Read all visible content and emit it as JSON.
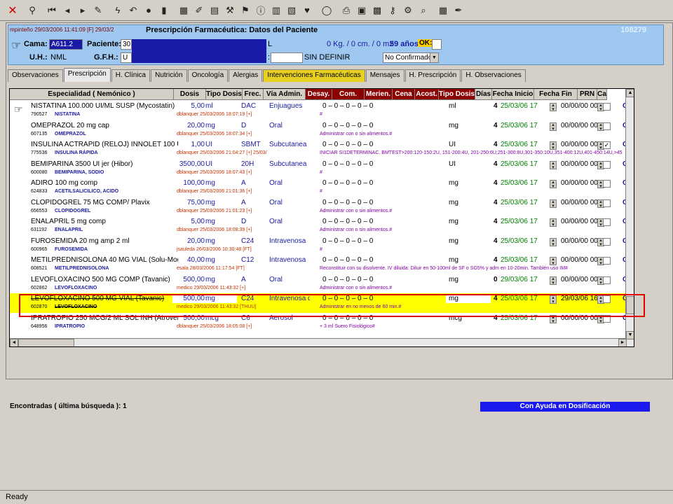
{
  "toolbar": {
    "icons": [
      "close-icon",
      "binoculars-icon",
      "first-icon",
      "prev-icon",
      "next-icon",
      "edit-icon",
      "lightning-icon",
      "undo-icon",
      "record-icon",
      "trash-icon",
      "grid-icon",
      "note-icon",
      "doc-icon",
      "tools-icon",
      "flag-icon",
      "info-icon",
      "table-icon",
      "book-icon",
      "heart-icon",
      "chat-icon",
      "print-icon",
      "photo-icon",
      "calc-icon",
      "key-icon",
      "gear-icon",
      "search-doc-icon",
      "calendar-icon",
      "pen-icon"
    ]
  },
  "patient": {
    "userinfo": "mpinteño 29/03/2006 11:41:09 [F] 29/03/2",
    "title": "Prescripción Farmacéutica: Datos del Paciente",
    "id": "108279",
    "cama_label": "Cama:",
    "cama_value": "A611.2",
    "paciente_label": "Paciente:",
    "paciente_value": "30",
    "paciente_tail": "L",
    "weight": "0 Kg. / 0 cm. / 0 m2",
    "age": "59 años",
    "ok_label": "OK:",
    "uh_label": "U.H.:",
    "uh_value": "NML",
    "gfh_label": "G.F.H.:",
    "gfh_value": "U",
    "def_label": ":",
    "def_status": "SIN DEFINIR",
    "confirm_select": "No Confirmado"
  },
  "tabs": [
    {
      "label": "Observaciones",
      "active": false,
      "hl": false
    },
    {
      "label": "Prescripción",
      "active": true,
      "hl": false
    },
    {
      "label": "H. Clínica",
      "active": false,
      "hl": false
    },
    {
      "label": "Nutrición",
      "active": false,
      "hl": false
    },
    {
      "label": "Oncología",
      "active": false,
      "hl": false
    },
    {
      "label": "Alergias",
      "active": false,
      "hl": false
    },
    {
      "label": "Intervenciones Farmacéuticas",
      "active": false,
      "hl": true
    },
    {
      "label": "Mensajes",
      "active": false,
      "hl": false
    },
    {
      "label": "H. Prescripción",
      "active": false,
      "hl": false
    },
    {
      "label": "H. Observaciones",
      "active": false,
      "hl": false
    }
  ],
  "columns": [
    {
      "label": "Especialidad ( Nemónico )",
      "dark": false
    },
    {
      "label": "Dosis",
      "dark": false
    },
    {
      "label": "Tipo Dosis",
      "dark": false
    },
    {
      "label": "Frec.",
      "dark": false
    },
    {
      "label": "Vía Admin.",
      "dark": false
    },
    {
      "label": "Desay.",
      "dark": true
    },
    {
      "label": "Com.",
      "dark": true
    },
    {
      "label": "Merien.",
      "dark": true
    },
    {
      "label": "Cena",
      "dark": true
    },
    {
      "label": "Acost.",
      "dark": true
    },
    {
      "label": "Tipo Dosis",
      "dark": true
    },
    {
      "label": "Días",
      "dark": false
    },
    {
      "label": "Fecha Inicio",
      "dark": false
    },
    {
      "label": "Fecha Fin",
      "dark": false
    },
    {
      "label": "PRN",
      "dark": false
    },
    {
      "label": "Ca",
      "dark": false
    }
  ],
  "rows": [
    {
      "name": "NISTATINA 100.000 UI/ML SUSP (Mycostatin)",
      "code": "790527",
      "generic": "NISTATINA",
      "dose": "5,00",
      "unit": "ml",
      "freq": "DAC",
      "via": "Enjuagues",
      "doctor": "dblanquer 25/03/2006 18:07:19 [+]",
      "sched": "0   –   0   –   0   –   0   –   0",
      "udm": "ml",
      "note": "#",
      "dias": "4",
      "fini": "25/03/06 17",
      "ffin": "00/00/00 00",
      "prn": "",
      "ca": "C",
      "hand": true
    },
    {
      "name": "OMEPRAZOL 20 mg cap",
      "code": "607135",
      "generic": "OMEPRAZOL",
      "dose": "20,00",
      "unit": "mg",
      "freq": "D",
      "via": "Oral",
      "doctor": "dblanquer 25/03/2006 18:07:34 [+]",
      "sched": "0   –   0   –   0   –   0   –   0",
      "udm": "mg",
      "note": "Administrar con o sin alimentos.#",
      "dias": "4",
      "fini": "25/03/06 17",
      "ffin": "00/00/00 00",
      "prn": "",
      "ca": "C",
      "hand": false
    },
    {
      "name": "INSULINA  ACTRAPID  (RELOJ)  INNOLET 100 UI.",
      "code": "775536",
      "generic": "INSULINA RÁPIDA",
      "dose": "1,00",
      "unit": "UI",
      "freq": "SBMT",
      "via": "Subcutanea",
      "doctor": "dblanquer 25/03/2006 21:04:27 [+] 25/03/",
      "sched": "0   –   0   –   0   –   0   –   0",
      "udm": "UI",
      "note": "INICIAR SI1DETERMINAC. BMTEST>200:120-150:2U, 151-200:4U, 201-250:6U;251-300:8U,301-350:10U,351-400:12U,401-450:14U,>45",
      "dias": "4",
      "fini": "25/03/06 17",
      "ffin": "00/00/00 00",
      "prn": "✓",
      "ca": "C",
      "hand": false
    },
    {
      "name": "BEMIPARINA 3500 UI jer (Hibor)",
      "code": "600080",
      "generic": "BEMIPARINA, SODIO",
      "dose": "3500,00",
      "unit": "UI",
      "freq": "20H",
      "via": "Subcutanea",
      "doctor": "dblanquer 25/03/2006 18:07:43 [+]",
      "sched": "0   –   0   –   0   –   0   –   0",
      "udm": "UI",
      "note": "#",
      "dias": "4",
      "fini": "25/03/06 17",
      "ffin": "00/00/00 00",
      "prn": "",
      "ca": "C",
      "hand": false
    },
    {
      "name": "ADIRO 100 mg comp",
      "code": "624833",
      "generic": "ACETILSALICILICO, ACIDO",
      "dose": "100,00",
      "unit": "mg",
      "freq": "A",
      "via": "Oral",
      "doctor": "dblanquer 25/03/2006 21:01:36 [+]",
      "sched": "0   –   0   –   0   –   0   –   0",
      "udm": "mg",
      "note": "#",
      "dias": "4",
      "fini": "25/03/06 17",
      "ffin": "00/00/00 00",
      "prn": "",
      "ca": "C",
      "hand": false
    },
    {
      "name": "CLOPIDOGREL 75 MG COMP/ Plavix",
      "code": "656553",
      "generic": "CLOPIDOGREL",
      "dose": "75,00",
      "unit": "mg",
      "freq": "A",
      "via": "Oral",
      "doctor": "dblanquer 25/03/2006 21:01:23 [+]",
      "sched": "0   –   0   –   0   –   0   –   0",
      "udm": "mg",
      "note": "Administrar con o sin alimentos.#",
      "dias": "4",
      "fini": "25/03/06 17",
      "ffin": "00/00/00 00",
      "prn": "",
      "ca": "C",
      "hand": false
    },
    {
      "name": "ENALAPRIL 5 mg comp",
      "code": "631192",
      "generic": "ENALAPRIL",
      "dose": "5,00",
      "unit": "mg",
      "freq": "D",
      "via": "Oral",
      "doctor": "dblanquer 25/03/2006 18:08:39 [+]",
      "sched": "0   –   0   –   0   –   0   –   0",
      "udm": "mg",
      "note": "Administrar con o sin alimentos.#",
      "dias": "4",
      "fini": "25/03/06 17",
      "ffin": "00/00/00 00",
      "prn": "",
      "ca": "C",
      "hand": false
    },
    {
      "name": "FUROSEMIDA  20 mg amp 2 ml",
      "code": "600965",
      "generic": "FUROSEMIDA",
      "dose": "20,00",
      "unit": "mg",
      "freq": "C24",
      "via": "Intravenosa",
      "doctor": "jsauleda 26/03/2006 10:30:48 [FT]",
      "sched": "0   –   0   –   0   –   0   –   0",
      "udm": "mg",
      "note": "#",
      "dias": "4",
      "fini": "25/03/06 17",
      "ffin": "00/00/00 00",
      "prn": "",
      "ca": "C",
      "hand": false
    },
    {
      "name": "METILPREDNISOLONA 40 MG VIAL (Solu-Moderin",
      "code": "608521",
      "generic": "METILPREDNISOLONA",
      "dose": "40,00",
      "unit": "mg",
      "freq": "C12",
      "via": "Intravenosa",
      "doctor": "esala 28/03/2006 11:17:54 [FT]",
      "sched": "0   –   0   –   0   –   0   –   0",
      "udm": "mg",
      "note": "Reconstituir con su disolvente. IV diluida: Diluir en 50-100ml de SF o SG5% y adm en 10-20min. También uso IM#",
      "dias": "4",
      "fini": "25/03/06 17",
      "ffin": "00/00/00 00",
      "prn": "",
      "ca": "C",
      "hand": false
    },
    {
      "name": "LEVOFLOXACINO 500 MG COMP (Tavanic)",
      "code": "602862",
      "generic": "LEVOFLOXACINO",
      "dose": "500,00",
      "unit": "mg",
      "freq": "A",
      "via": "Oral",
      "doctor": "medico 29/03/2006 11:43:32 [+]",
      "sched": "0   –   0   –   0   –   0   –   0",
      "udm": "mg",
      "note": "Administrar con o sin alimentos.#",
      "dias": "0",
      "fini": "29/03/06 17",
      "ffin": "00/00/00 00",
      "prn": "",
      "ca": "C",
      "hand": false
    },
    {
      "name": "LEVOFLOXACINO 500 MG VIAL (Tavanic)",
      "code": "602870",
      "generic": "LEVOFLOXACINO",
      "dose": "500,00",
      "unit": "mg",
      "freq": "C24",
      "via": "Intravenosa dilu",
      "doctor": "medico 29/03/2006 11:43:32 [THUU]",
      "sched": "0   –   0   –   0   –   0   –   0",
      "udm": "mg",
      "note": "Administrar en no menos de 60 min.#",
      "dias": "4",
      "fini": "25/03/06 17",
      "ffin": "29/03/06 16",
      "prn": "",
      "ca": "C",
      "hand": false,
      "selected": true
    },
    {
      "name": "IPRATROPIO 250 MCG/2 ML SOL INH (Atrovent)",
      "code": "648956",
      "generic": "IPRATROPIO",
      "dose": "500,00",
      "unit": "mcg",
      "freq": "C6",
      "via": "Aerosol",
      "doctor": "dblanquer 25/03/2006 18:05:08 [+]",
      "sched": "0   –   0   –   0   –   0   –   0",
      "udm": "mcg",
      "note": "+ 3 ml Suero Fisiológico#",
      "dias": "4",
      "fini": "25/03/06 17",
      "ffin": "00/00/00 00",
      "prn": "",
      "ca": "C",
      "hand": false
    }
  ],
  "found_text": "Encontradas ( última búsqueda ): 1",
  "help_button": "Con Ayuda en Dosificación",
  "status": "Ready",
  "colors": {
    "header_blue": "#9ec8f0",
    "selected_row": "#ffff00",
    "highlight_box": "#e00000",
    "help_blue": "#1a1aee",
    "dark_header": "#8b0000"
  }
}
